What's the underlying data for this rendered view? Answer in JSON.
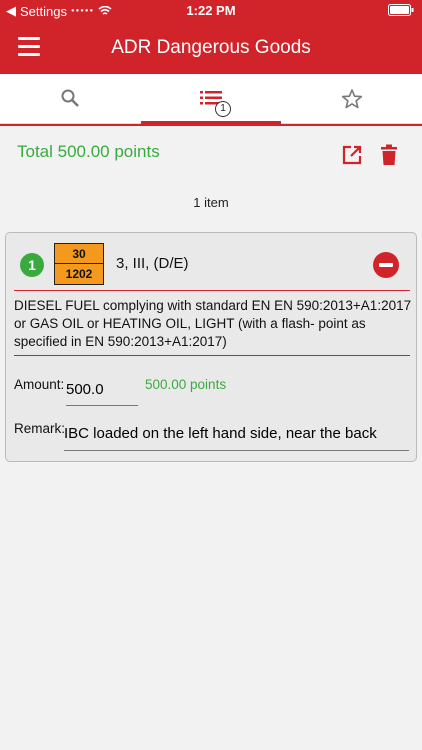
{
  "status": {
    "carrier": "Settings",
    "time": "1:22 PM"
  },
  "app": {
    "title": "ADR Dangerous Goods"
  },
  "tabs": [
    {
      "name": "search",
      "icon": "search-icon"
    },
    {
      "name": "list",
      "icon": "list-icon",
      "badge": "1",
      "active": true
    },
    {
      "name": "favorites",
      "icon": "star-icon"
    }
  ],
  "summary": {
    "total": "Total 500.00 points",
    "count": "1 item"
  },
  "item": {
    "index": "1",
    "plate_top": "30",
    "plate_bottom": "1202",
    "class_info": "3, III, (D/E)",
    "description": "DIESEL FUEL complying with standard EN EN 590:2013+A1:2017 or GAS OIL or HEATING OIL, LIGHT (with a flash- point as specified in EN 590:2013+A1:2017)",
    "amount_label": "Amount:",
    "amount_value": "500.0",
    "amount_points": "500.00 points",
    "remark_label": "Remark:",
    "remark_value": "IBC loaded on the left hand side, near the back"
  },
  "colors": {
    "brand": "#d0232a",
    "points": "#3aaa3f",
    "plate": "#f39a1e"
  }
}
